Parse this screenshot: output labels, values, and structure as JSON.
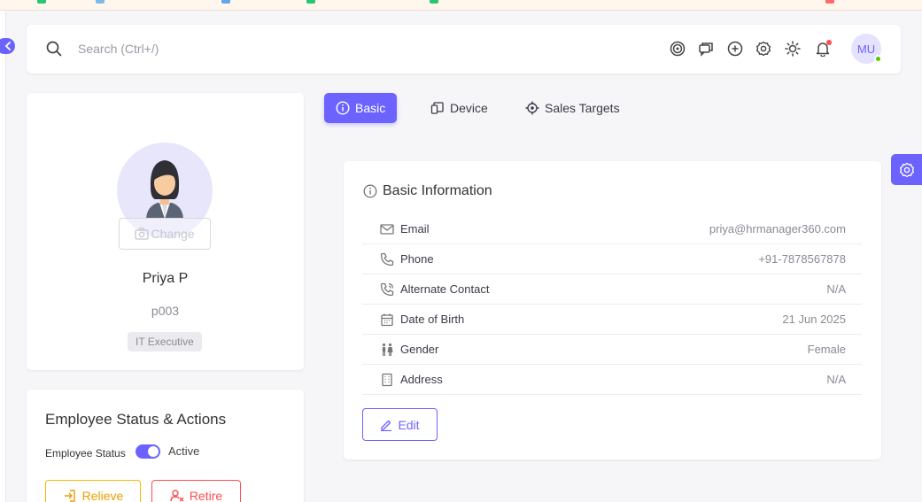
{
  "search": {
    "placeholder": "Search (Ctrl+/)"
  },
  "topbar": {
    "icons": [
      "target-icon",
      "chat-icon",
      "add-circle-icon",
      "settings-icon",
      "theme-sun-icon",
      "notification-bell-icon"
    ],
    "user_initials": "MU",
    "online_status_color": "#56ca00"
  },
  "profile": {
    "change_label": "Change",
    "name": "Priya P",
    "code": "p003",
    "role": "IT Executive"
  },
  "status_card": {
    "title": "Employee Status & Actions",
    "status_label": "Employee Status",
    "status_value": "Active",
    "relieve_label": "Relieve",
    "retire_label": "Retire"
  },
  "tabs": [
    {
      "label": "Basic",
      "icon": "info-icon",
      "active": true
    },
    {
      "label": "Device",
      "icon": "device-icon",
      "active": false
    },
    {
      "label": "Sales Targets",
      "icon": "target-icon",
      "active": false
    }
  ],
  "basic_info": {
    "title": "Basic Information",
    "rows": [
      {
        "icon": "mail-icon",
        "label": "Email",
        "value": "priya@hrmanager360.com"
      },
      {
        "icon": "phone-icon",
        "label": "Phone",
        "value": "+91-7878567878"
      },
      {
        "icon": "phone-call-icon",
        "label": "Alternate Contact",
        "value": "N/A"
      },
      {
        "icon": "calendar-icon",
        "label": "Date of Birth",
        "value": "21 Jun 2025"
      },
      {
        "icon": "gender-icon",
        "label": "Gender",
        "value": "Female"
      },
      {
        "icon": "building-icon",
        "label": "Address",
        "value": "N/A"
      }
    ],
    "edit_label": "Edit"
  },
  "colors": {
    "primary": "#6c63ff",
    "warning": "#ffb400",
    "danger": "#ff4c51",
    "success": "#56ca00"
  }
}
